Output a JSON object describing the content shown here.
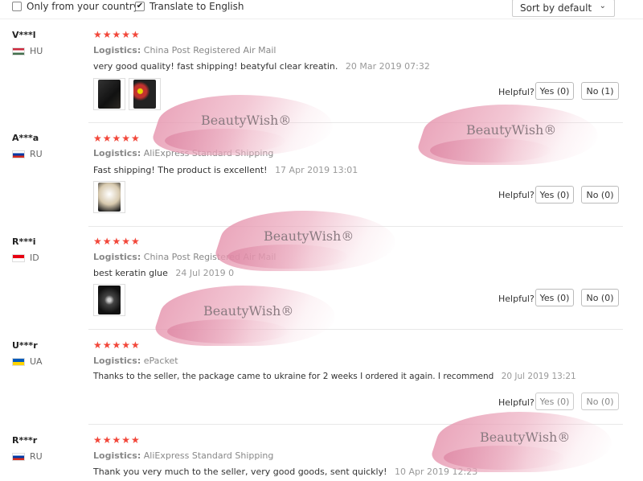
{
  "filters": {
    "only_country": {
      "label": "Only from your country",
      "checked": false
    },
    "translate": {
      "label": "Translate to English",
      "checked": true
    }
  },
  "sort": {
    "selected": "Sort by default"
  },
  "logistics_label": "Logistics:",
  "helpful_label": "Helpful?",
  "watermark": "BeautyWish®",
  "rating": "★★★★★",
  "reviews": [
    {
      "user": "V***l",
      "country": "HU",
      "logistics": "China Post Registered Air Mail",
      "comment": "very good quality! fast shipping! beatyful clear kreatin.",
      "date": "20 Mar 2019 07:32",
      "yes": "Yes (0)",
      "no": "No (1)"
    },
    {
      "user": "A***a",
      "country": "RU",
      "logistics": "AliExpress Standard Shipping",
      "comment": "Fast shipping! The product is excellent!",
      "date": "17 Apr 2019 13:01",
      "yes": "Yes (0)",
      "no": "No (0)"
    },
    {
      "user": "R***i",
      "country": "ID",
      "logistics": "China Post Registered Air Mail",
      "comment": "best keratin glue",
      "date": "24 Jul 2019 0",
      "yes": "Yes (0)",
      "no": "No (0)"
    },
    {
      "user": "U***r",
      "country": "UA",
      "logistics": "ePacket",
      "comment": "Thanks to the seller, the package came to ukraine for 2 weeks I ordered it again. I recommend",
      "date": "20 Jul 2019 13:21",
      "yes": "Yes (0)",
      "no": "No (0)"
    },
    {
      "user": "R***r",
      "country": "RU",
      "logistics": "AliExpress Standard Shipping",
      "comment": "Thank you very much to the seller, very good goods, sent quickly!",
      "date": "10 Apr 2019 12:23"
    }
  ]
}
